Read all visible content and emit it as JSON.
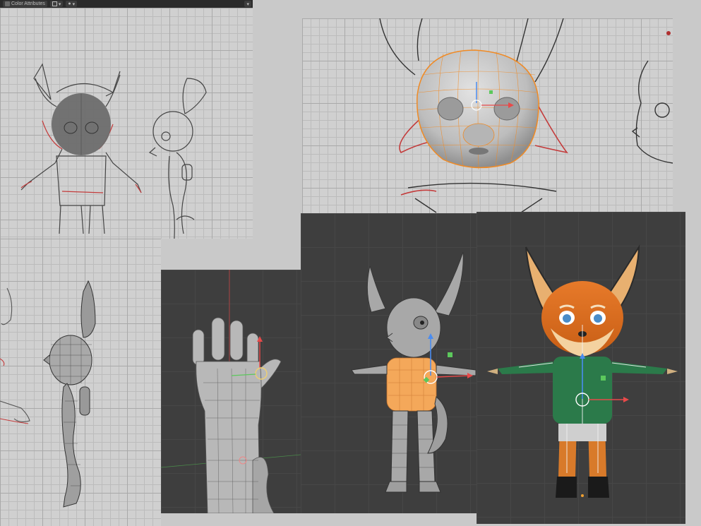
{
  "toolbar": {
    "color_label": "Color Attributes",
    "color_swatch": "#6b6b6b",
    "dropdown_glyph": "▾",
    "dot_glyph": "●"
  },
  "panels": {
    "sketch_overview": {
      "bg": "#d0d0d0"
    },
    "head_closeup": {
      "bg": "#d6d6d6",
      "accent": "#f08a24"
    },
    "side_mesh": {
      "bg": "#d0d0d0"
    },
    "hand_mesh": {
      "bg": "#3e3e3e"
    },
    "body_mesh": {
      "bg": "#404040",
      "accent": "#f4a85a"
    },
    "textured_rig": {
      "bg": "#3c3c3c"
    }
  },
  "gizmo_colors": {
    "x": "#e84a4a",
    "y": "#5cc85c",
    "z": "#4a8cf0",
    "select": "#f0a030"
  }
}
